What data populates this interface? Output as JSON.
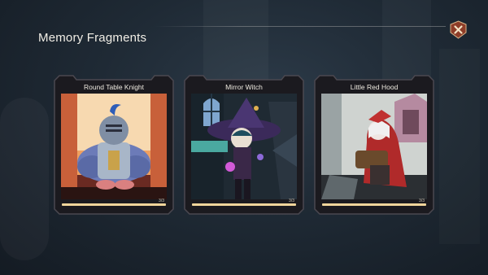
{
  "header": {
    "title": "Memory Fragments",
    "close_icon": "close-x-icon"
  },
  "colors": {
    "accent": "#f0d59b",
    "close_bg": "#8e3d28",
    "frame": "#1b1a1f"
  },
  "cards": [
    {
      "title": "Round Table Knight",
      "count": "3/3",
      "progress": 1.0
    },
    {
      "title": "Mirror Witch",
      "count": "3/3",
      "progress": 1.0
    },
    {
      "title": "Little Red Hood",
      "count": "3/3",
      "progress": 1.0
    }
  ]
}
